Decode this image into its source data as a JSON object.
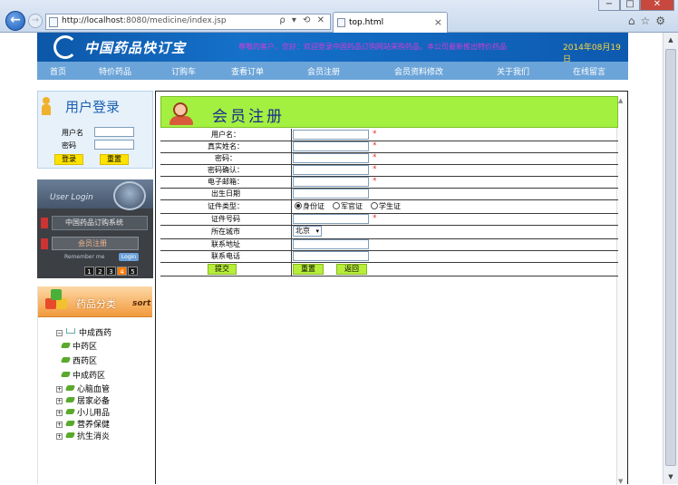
{
  "browser": {
    "url_host": "http://localhost",
    "url_rest": ":8080/medicine/index.jsp",
    "tab_title": "top.html",
    "address_tools": "ρ ▾ ⟲ ✕",
    "win_min": "−",
    "win_max": "□",
    "win_close": "✕"
  },
  "site": {
    "logo_text": "中国药品快订宝",
    "marquee": "尊敬的客户，您好：欢迎登录中国药品订购网站采购药品，本公司最新推出特价药品",
    "date": "2014年08月19日",
    "menu": [
      "首页",
      "特价药品",
      "订购车",
      "查看订单",
      "会员注册",
      "会员资料修改",
      "关于我们",
      "在线留言"
    ]
  },
  "login_box": {
    "title": "用户登录",
    "username_label": "用户名",
    "password_label": "密码",
    "login_button": "登录",
    "reset_button": "重置"
  },
  "user_banner": {
    "header": "User Login",
    "system_name": "中国药品订购系统",
    "register": "会员注册",
    "remember": "Remember me",
    "login": "Login",
    "pages": [
      "1",
      "2",
      "3",
      "4",
      "5"
    ],
    "active_page": "4"
  },
  "category": {
    "title": "药品分类",
    "sort": "sort",
    "tree": [
      {
        "label": "中成西药",
        "kind": "folder-open"
      },
      {
        "label": "中药区",
        "kind": "child"
      },
      {
        "label": "西药区",
        "kind": "child"
      },
      {
        "label": "中成药区",
        "kind": "child"
      },
      {
        "label": "心脑血管",
        "kind": "collapsed"
      },
      {
        "label": "居家必备",
        "kind": "collapsed"
      },
      {
        "label": "小儿用品",
        "kind": "collapsed"
      },
      {
        "label": "营养保健",
        "kind": "collapsed"
      },
      {
        "label": "抗生消炎",
        "kind": "collapsed"
      }
    ]
  },
  "registration": {
    "title": "会员注册",
    "required_mark": "*",
    "fields": {
      "username": "用户名：",
      "realname": "真实姓名：",
      "password": "密码：",
      "password_confirm": "密码确认：",
      "email": "电子邮箱：",
      "birthday": "出生日期",
      "id_type": "证件类型：",
      "id_number": "证件号码",
      "city": "所在城市",
      "address": "联系地址",
      "phone": "联系电话"
    },
    "id_types": [
      "身份证",
      "军官证",
      "学生证"
    ],
    "city_selected": "北京",
    "submit": "提交",
    "reset": "重置",
    "back": "返回"
  },
  "colors": {
    "banner_blue": "#0c57a8",
    "menu_blue": "#6ba4d8",
    "reg_green": "#a3f041",
    "button_yellow": "#ffe300"
  }
}
